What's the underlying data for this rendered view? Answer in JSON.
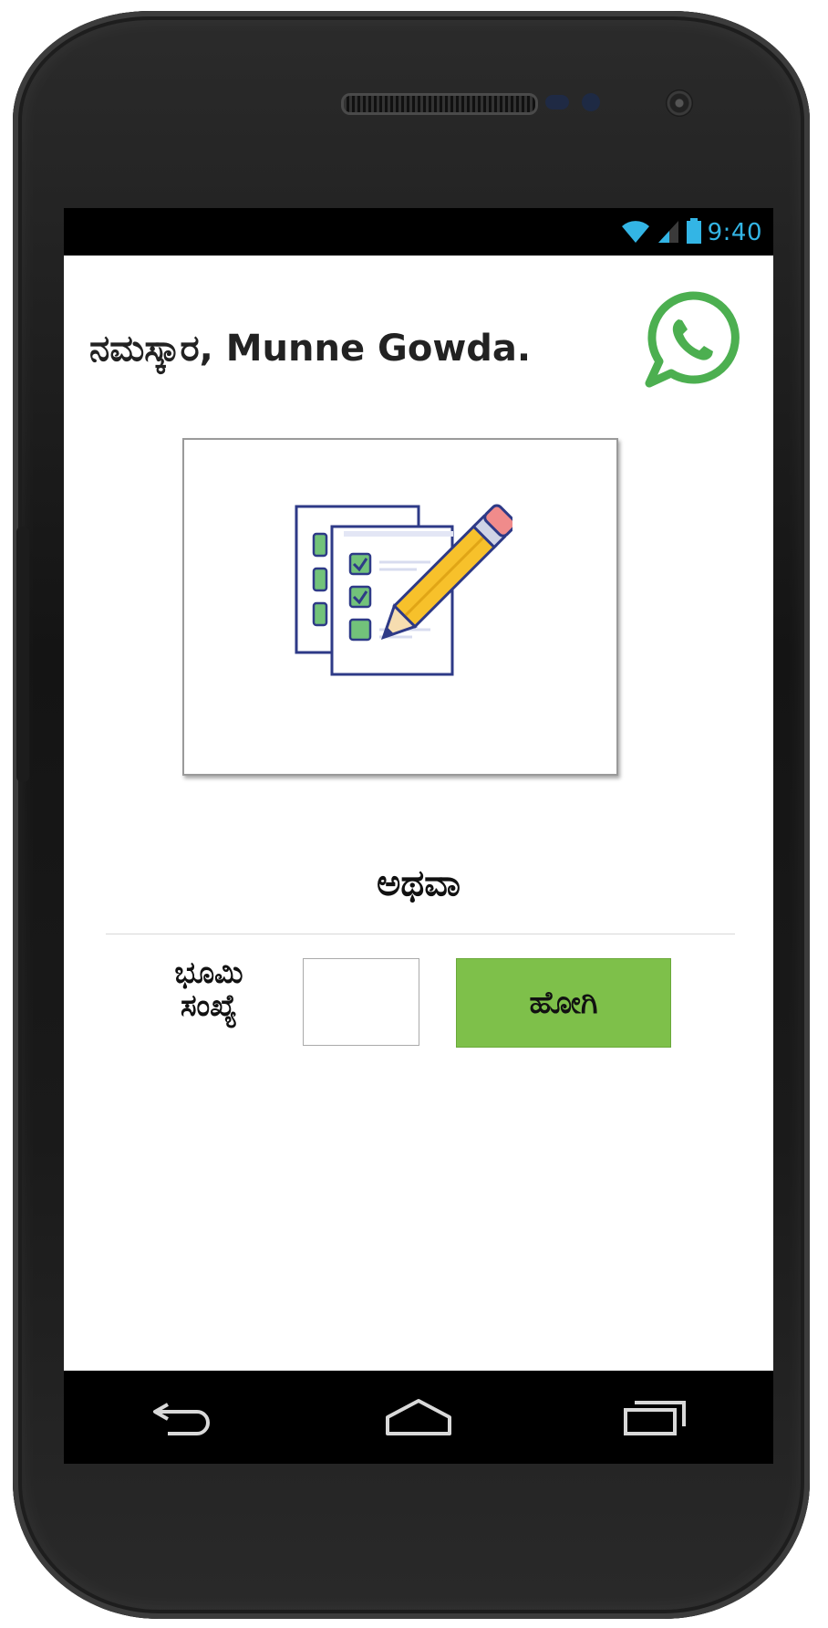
{
  "status_bar": {
    "time": "9:40",
    "icons": [
      "wifi-icon",
      "signal-icon",
      "battery-icon"
    ],
    "accent_color": "#33b5e5"
  },
  "header": {
    "greeting": "ನಮಸ್ಕಾರ, Munne Gowda.",
    "whatsapp_icon": "whatsapp-icon",
    "whatsapp_color": "#4caf50"
  },
  "survey_card": {
    "icon": "checklist-pencil-icon"
  },
  "separator": {
    "label": "ಅಥವಾ"
  },
  "land_form": {
    "label_line1": "ಭೂಮಿ",
    "label_line2": "ಸಂಖ್ಯೆ",
    "input_value": "",
    "go_label": "ಹೋಗಿ",
    "go_color": "#7ec04a"
  },
  "nav_bar": {
    "icons": [
      "back-icon",
      "home-icon",
      "recent-apps-icon"
    ]
  }
}
